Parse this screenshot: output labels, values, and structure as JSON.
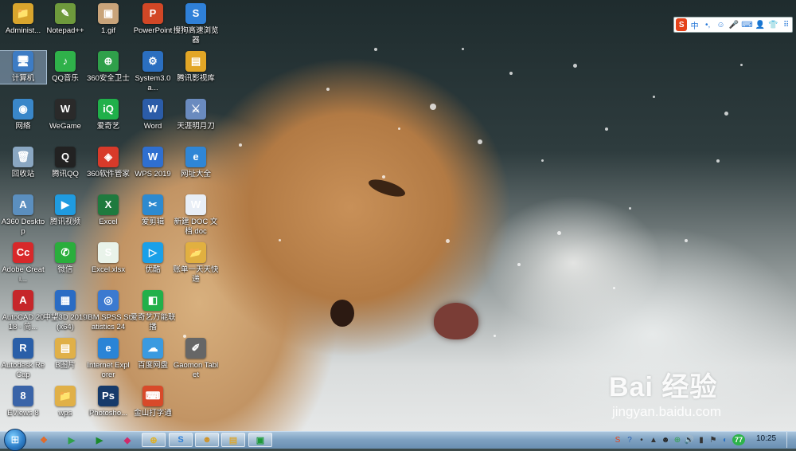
{
  "desktop": {
    "icons": [
      {
        "label": "Administ...",
        "icon": "user-folder-icon",
        "color": "#d9a52d",
        "glyph": "📁"
      },
      {
        "label": "Notepad++",
        "icon": "notepad-plus-plus-icon",
        "color": "#6e9a3c",
        "glyph": "✎"
      },
      {
        "label": "1.gif",
        "icon": "gif-image-icon",
        "color": "#c9a47a",
        "glyph": "▣"
      },
      {
        "label": "PowerPoint",
        "icon": "powerpoint-icon",
        "color": "#d24726",
        "glyph": "P"
      },
      {
        "label": "搜狗高速浏览器",
        "icon": "sogou-browser-icon",
        "color": "#2f80d8",
        "glyph": "S"
      },
      {
        "label": "计算机",
        "icon": "computer-icon",
        "color": "#3d7cc4",
        "glyph": "🖥"
      },
      {
        "label": "QQ音乐",
        "icon": "qq-music-icon",
        "color": "#2fb14a",
        "glyph": "♪"
      },
      {
        "label": "360安全卫士",
        "icon": "360-security-icon",
        "color": "#2fa04a",
        "glyph": "⊕"
      },
      {
        "label": "System3.0a...",
        "icon": "system-settings-icon",
        "color": "#2b6fc0",
        "glyph": "⚙"
      },
      {
        "label": "腾讯影视库",
        "icon": "tencent-video-library-icon",
        "color": "#e2a626",
        "glyph": "▤"
      },
      {
        "label": "网络",
        "icon": "network-icon",
        "color": "#3a87c9",
        "glyph": "◉"
      },
      {
        "label": "WeGame",
        "icon": "wegame-icon",
        "color": "#2a2a2a",
        "glyph": "W"
      },
      {
        "label": "爱奇艺",
        "icon": "iqiyi-icon",
        "color": "#20b04a",
        "glyph": "iQ"
      },
      {
        "label": "Word",
        "icon": "word-icon",
        "color": "#2b5ca8",
        "glyph": "W"
      },
      {
        "label": "天涯明月刀",
        "icon": "game-sword-icon",
        "color": "#6a8bbf",
        "glyph": "⚔"
      },
      {
        "label": "回收站",
        "icon": "recycle-bin-icon",
        "color": "#8aa7c2",
        "glyph": "🗑"
      },
      {
        "label": "腾讯QQ",
        "icon": "qq-icon",
        "color": "#222222",
        "glyph": "Q"
      },
      {
        "label": "360软件管家",
        "icon": "360-software-manager-icon",
        "color": "#d83a2a",
        "glyph": "◈"
      },
      {
        "label": "WPS 2019",
        "icon": "wps-icon",
        "color": "#2f6fd0",
        "glyph": "W"
      },
      {
        "label": "网址大全",
        "icon": "web-directory-icon",
        "color": "#2f86d6",
        "glyph": "e"
      },
      {
        "label": "A360 Desktop",
        "icon": "a360-desktop-icon",
        "color": "#5b8fbf",
        "glyph": "A"
      },
      {
        "label": "腾讯视频",
        "icon": "tencent-video-icon",
        "color": "#1f9be0",
        "glyph": "▶"
      },
      {
        "label": "Excel",
        "icon": "excel-icon",
        "color": "#1f7a3e",
        "glyph": "X"
      },
      {
        "label": "爱剪辑",
        "icon": "aijianji-icon",
        "color": "#2d8ad0",
        "glyph": "✂"
      },
      {
        "label": "新建 DOC 文档.doc",
        "icon": "doc-file-icon",
        "color": "#e8eef6",
        "glyph": "W"
      },
      {
        "label": "Adobe Creati...",
        "icon": "adobe-creative-cloud-icon",
        "color": "#d8282a",
        "glyph": "Cc"
      },
      {
        "label": "微信",
        "icon": "wechat-icon",
        "color": "#2aae3c",
        "glyph": "✆"
      },
      {
        "label": "Excel.xlsx",
        "icon": "xlsx-file-icon",
        "color": "#e9f3ea",
        "glyph": "S"
      },
      {
        "label": "优酷",
        "icon": "youku-icon",
        "color": "#1aa0e8",
        "glyph": "▷"
      },
      {
        "label": "账单一天天快递",
        "icon": "bill-folder-icon",
        "color": "#e1b040",
        "glyph": "📂"
      },
      {
        "label": "AutoCAD 2018 - 简...",
        "icon": "autocad-icon",
        "color": "#c6262a",
        "glyph": "A"
      },
      {
        "label": "中望3D 2019 (x64)",
        "icon": "zw3d-icon",
        "color": "#2a6cc4",
        "glyph": "▦"
      },
      {
        "label": "IBM SPSS Statistics 24",
        "icon": "spss-icon",
        "color": "#3c7ad0",
        "glyph": "◎"
      },
      {
        "label": "爱奇艺万能联播",
        "icon": "iqiyi-player-icon",
        "color": "#22b04a",
        "glyph": "◧"
      },
      {
        "label": "Autodesk ReCap",
        "icon": "recap-icon",
        "color": "#2a5fa8",
        "glyph": "R"
      },
      {
        "label": "B图片",
        "icon": "image-folder-icon",
        "color": "#e0b048",
        "glyph": "▤"
      },
      {
        "label": "Internet Explorer",
        "icon": "internet-explorer-icon",
        "color": "#2a84d6",
        "glyph": "e"
      },
      {
        "label": "百度网盘",
        "icon": "baidu-netdisk-icon",
        "color": "#3a9ae0",
        "glyph": "☁"
      },
      {
        "label": "Gaomon Tablet",
        "icon": "tablet-driver-icon",
        "color": "#666666",
        "glyph": "✐"
      },
      {
        "label": "EViews 8",
        "icon": "eviews-icon",
        "color": "#3a64a8",
        "glyph": "8"
      },
      {
        "label": "wps",
        "icon": "wps-folder-icon",
        "color": "#e0b048",
        "glyph": "📁"
      },
      {
        "label": "Photosho...",
        "icon": "photoshop-icon",
        "color": "#163a6a",
        "glyph": "Ps"
      },
      {
        "label": "金山打字通",
        "icon": "typing-tutor-icon",
        "color": "#d84a2a",
        "glyph": "⌨"
      }
    ]
  },
  "ime_bar": {
    "logo": "S",
    "mode": "中",
    "items": [
      "•,",
      "☺",
      "🎤",
      "⌨",
      "👤",
      "👕",
      "⠿"
    ]
  },
  "watermark": {
    "brand": "Bai 经验",
    "url": "jingyan.baidu.com"
  },
  "taskbar": {
    "start_glyph": "⊞",
    "pinned": [
      {
        "icon": "windows-logo-icon",
        "glyph": "❖",
        "color": "#e06a2a"
      },
      {
        "icon": "media-player-icon",
        "glyph": "▶",
        "color": "#2fa04a"
      },
      {
        "icon": "iqiyi-taskbar-icon",
        "glyph": "▶",
        "color": "#1a8a2a"
      },
      {
        "icon": "youku-taskbar-icon",
        "glyph": "◆",
        "color": "#d02a6a"
      },
      {
        "icon": "360-taskbar-icon",
        "glyph": "⊕",
        "color": "#e0b020"
      },
      {
        "icon": "sogou-taskbar-icon",
        "glyph": "S",
        "color": "#2f80d8"
      },
      {
        "icon": "qq-taskbar-icon",
        "glyph": "☻",
        "color": "#d09020"
      },
      {
        "icon": "explorer-taskbar-icon",
        "glyph": "▤",
        "color": "#d8a83a"
      },
      {
        "icon": "iqiyi-player-taskbar-icon",
        "glyph": "▣",
        "color": "#1e9a3a"
      }
    ],
    "tray": [
      {
        "icon": "sogou-tray-icon",
        "glyph": "S",
        "color": "#e5421a"
      },
      {
        "icon": "help-tray-icon",
        "glyph": "?",
        "color": "#2a5fb0"
      },
      {
        "icon": "dots-tray-icon",
        "glyph": "•",
        "color": "#333333"
      },
      {
        "icon": "arrow-tray-icon",
        "glyph": "▲",
        "color": "#333333"
      },
      {
        "icon": "qq-tray-icon",
        "glyph": "☻",
        "color": "#222222"
      },
      {
        "icon": "360-tray-icon",
        "glyph": "⊕",
        "color": "#2fa04a"
      },
      {
        "icon": "volume-icon",
        "glyph": "🔊",
        "color": "#333333"
      },
      {
        "icon": "network-signal-icon",
        "glyph": "▮",
        "color": "#333333"
      },
      {
        "icon": "action-center-icon",
        "glyph": "⚑",
        "color": "#333333"
      },
      {
        "icon": "antivirus-tray-icon",
        "glyph": "◐",
        "color": "#2a6fc0"
      }
    ],
    "badge_number": "77",
    "clock": "10:25"
  }
}
